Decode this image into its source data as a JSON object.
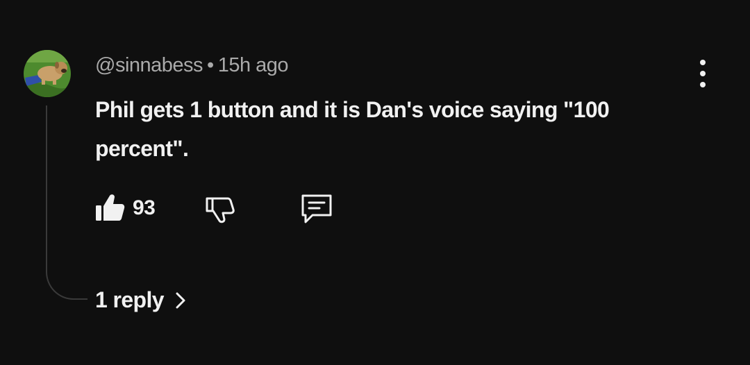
{
  "comment": {
    "author": "@sinnabess",
    "separator": "•",
    "time": "15h ago",
    "text": "Phil gets 1 button and it is Dan's voice saying \"100 percent\".",
    "like_count": "93",
    "replies_label": "1 reply"
  },
  "icons": {
    "avatar": "dog-on-grass-avatar",
    "menu": "more-vert-icon",
    "like": "thumbs-up-filled-icon",
    "dislike": "thumbs-down-outline-icon",
    "reply": "comment-bubble-icon",
    "expand": "chevron-right-icon"
  },
  "colors": {
    "background": "#0f0f0f",
    "primary_text": "#f1f1f1",
    "secondary_text": "#aaaaaa",
    "thread_line": "#3a3a3a"
  }
}
